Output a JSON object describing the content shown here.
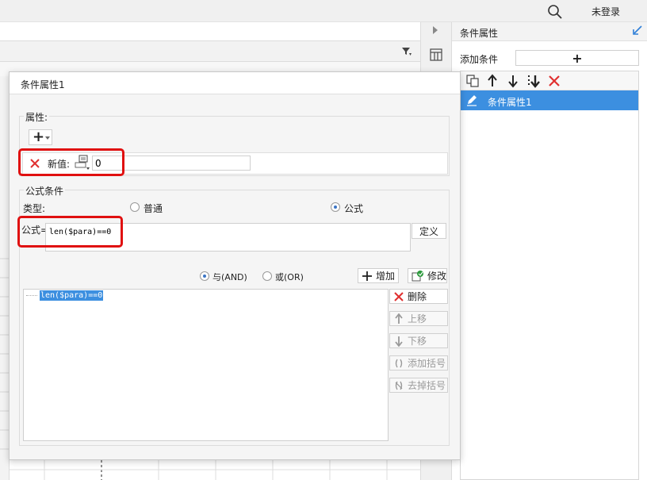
{
  "topbar": {
    "login_label": "未登录"
  },
  "right_panel": {
    "title": "条件属性",
    "add_condition_label": "添加条件",
    "add_button_label": "+",
    "items": [
      {
        "label": "条件属性1"
      }
    ]
  },
  "dialog": {
    "title": "条件属性1",
    "properties_label": "属性",
    "properties_colon": ":",
    "add_property_symbol": "+",
    "property_row": {
      "name_label": "新值:",
      "value": "0"
    },
    "formula_condition": {
      "legend": "公式条件",
      "type_label": "类型:",
      "type_options": [
        {
          "label": "普通",
          "selected": false
        },
        {
          "label": "公式",
          "selected": true
        }
      ],
      "formula_label": "公式=",
      "formula_value": "len($para)==0",
      "define_button": "定义",
      "logic_options": [
        {
          "label": "与(AND)",
          "selected": true
        },
        {
          "label": "或(OR)",
          "selected": false
        }
      ],
      "add_button": "增加",
      "modify_button": "修改",
      "conditions": [
        "len($para)==0"
      ],
      "delete_button": "删除",
      "move_up_button": "上移",
      "move_down_button": "下移",
      "add_paren_button": "添加括号",
      "remove_paren_button": "去掉括号"
    }
  },
  "colors": {
    "selection_blue": "#3c8fe0",
    "highlight_red": "#e01010",
    "delete_red": "#e03030"
  }
}
